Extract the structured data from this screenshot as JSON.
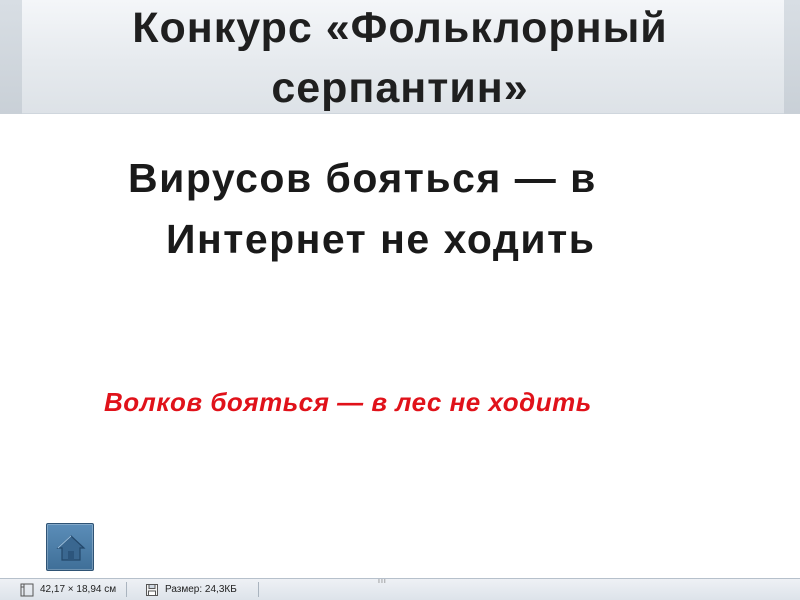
{
  "slide": {
    "title": "Конкурс «Фольклорный серпантин»",
    "main_line1": "Вирусов бояться — в",
    "main_line2": "Интернет не ходить",
    "red_text": "Волков бояться — в лес не ходить",
    "colors": {
      "accent_red": "#e0121a",
      "home_button": "#4a7aa5"
    }
  },
  "home_button": {
    "icon": "home-icon"
  },
  "status_bar": {
    "dimensions": "42,17 × 18,94 см",
    "size": "Размер: 24,3КБ",
    "dimensions_icon": "ruler-icon",
    "size_icon": "disk-icon"
  }
}
